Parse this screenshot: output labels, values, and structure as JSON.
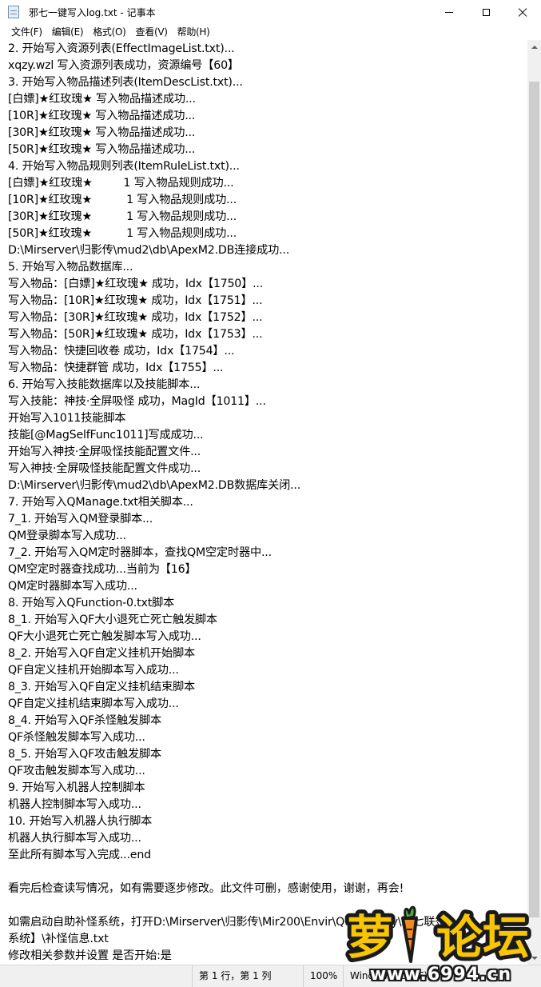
{
  "window": {
    "title": "邪七一键写入log.txt - 记事本"
  },
  "menu": [
    "文件(F)",
    "编辑(E)",
    "格式(O)",
    "查看(V)",
    "帮助(H)"
  ],
  "lines": [
    "2. 开始写入资源列表(EffectImageList.txt)...",
    "xqzy.wzl 写入资源列表成功，资源编号【60】",
    "3. 开始写入物品描述列表(ItemDescList.txt)...",
    "[白嫖]★红玫瑰★ 写入物品描述成功...",
    "[10R]★红玫瑰★ 写入物品描述成功...",
    "[30R]★红玫瑰★ 写入物品描述成功...",
    "[50R]★红玫瑰★ 写入物品描述成功...",
    "4. 开始写入物品规则列表(ItemRuleList.txt)...",
    "[白嫖]★红玫瑰★         1 写入物品规则成功...",
    "[10R]★红玫瑰★          1 写入物品规则成功...",
    "[30R]★红玫瑰★          1 写入物品规则成功...",
    "[50R]★红玫瑰★          1 写入物品规则成功...",
    "D:\\Mirserver\\归影传\\mud2\\db\\ApexM2.DB连接成功...",
    "5. 开始写入物品数据库...",
    "写入物品：[白嫖]★红玫瑰★ 成功，Idx【1750】...",
    "写入物品：[10R]★红玫瑰★ 成功，Idx【1751】...",
    "写入物品：[30R]★红玫瑰★ 成功，Idx【1752】...",
    "写入物品：[50R]★红玫瑰★ 成功，Idx【1753】...",
    "写入物品：快捷回收卷 成功，Idx【1754】...",
    "写入物品：快捷群管 成功，Idx【1755】...",
    "6. 开始写入技能数据库以及技能脚本...",
    "写入技能：神技·全屏吸怪 成功，MagId【1011】...",
    "开始写入1011技能脚本",
    "技能[@MagSelfFunc1011]写成成功...",
    "开始写入神技·全屏吸怪技能配置文件...",
    "写入神技·全屏吸怪技能配置文件成功...",
    "D:\\Mirserver\\归影传\\mud2\\db\\ApexM2.DB数据库关闭...",
    "7. 开始写入QManage.txt相关脚本...",
    "7_1. 开始写入QM登录脚本...",
    "QM登录脚本写入成功...",
    "7_2. 开始写入QM定时器脚本，查找QM空定时器中...",
    "QM空定时器查找成功...当前为【16】",
    "QM定时器脚本写入成功...",
    "8. 开始写入QFunction-0.txt脚本",
    "8_1. 开始写入QF大小退死亡死亡触发脚本",
    "QF大小退死亡死亡触发脚本写入成功...",
    "8_2. 开始写入QF自定义挂机开始脚本",
    "QF自定义挂机开始脚本写入成功...",
    "8_3. 开始写入QF自定义挂机结束脚本",
    "QF自定义挂机结束脚本写入成功...",
    "8_4. 开始写入QF杀怪触发脚本",
    "QF杀怪触发脚本写入成功...",
    "8_5. 开始写入QF攻击触发脚本",
    "QF攻击触发脚本写入成功...",
    "9. 开始写入机器人控制脚本",
    "机器人控制脚本写入成功...",
    "10. 开始写入机器人执行脚本",
    "机器人执行脚本写入成功...",
    "至此所有脚本写入完成...end",
    "",
    "看完后检查读写情况，如有需要逐步修改。此文件可删，感谢使用，谢谢，再会!",
    "",
    "如需启动自助补怪系统，打开D:\\Mirserver\\归影传\\Mir200\\Envir\\QuestDiary\\邪七联签",
    "系统】\\补怪信息.txt",
    "修改相关参数并设置 是否开始:是"
  ],
  "status": {
    "position": "第 1 行，第 1 列",
    "zoom": "100%",
    "line_ending": "Windows (CRLF)"
  },
  "watermark": {
    "logo_text": "萝卜论坛",
    "url": "www.6994.cn"
  },
  "colors": {
    "logo_yellow": "#f7c600",
    "logo_outline": "#1a1a1a",
    "carrot": "#f08a1c"
  }
}
